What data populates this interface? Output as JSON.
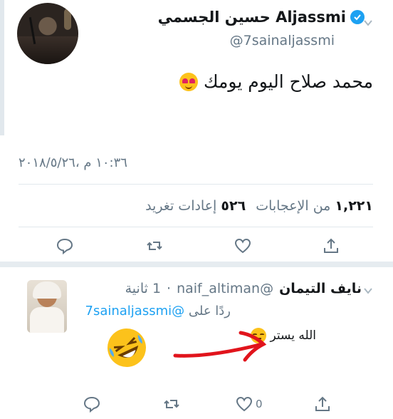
{
  "main_tweet": {
    "display_name": "حسين الجسمي Aljassmi",
    "handle": "@7sainaljassmi",
    "text": "محمد صلاح اليوم يومك",
    "emoji": "heart-eyes-emoji",
    "timestamp": "١٠:٣٦ م ،٢٠١٨/٥/٢٦",
    "likes_count": "١,٢٢١",
    "likes_label": "من الإعجابات",
    "retweets_count": "٥٢٦",
    "retweets_label": "إعادات تغريد"
  },
  "reply": {
    "display_name": "نايف التيمان",
    "handle": "@naif_altiman",
    "separator": "·",
    "time": "1 ثانية",
    "replying_prefix": "ردًا على",
    "replying_handle": "@7sainaljassmi",
    "text": "الله يستر",
    "like_count": "0"
  },
  "colors": {
    "verified": "#1da1f2",
    "icon_gray": "#657786",
    "divider": "#e1e8ed",
    "arrow_red": "#e1141c"
  },
  "icons": [
    "reply-icon",
    "retweet-icon",
    "like-icon",
    "share-icon",
    "chevron-down-icon",
    "verified-badge-icon"
  ]
}
